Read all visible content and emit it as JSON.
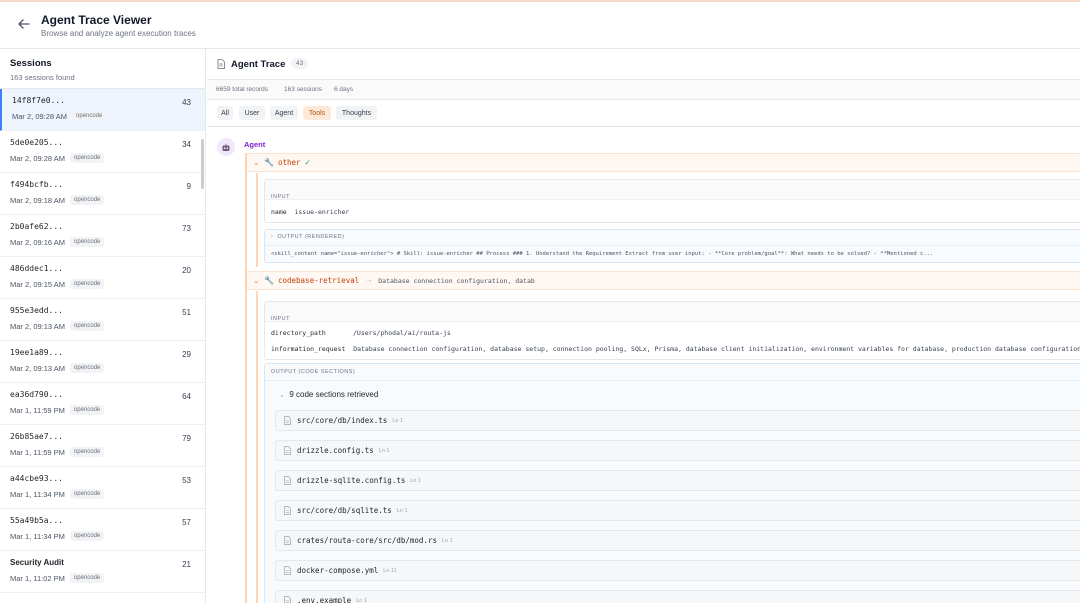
{
  "header": {
    "title": "Agent Trace Viewer",
    "subtitle": "Browse and analyze agent execution traces"
  },
  "sidebar": {
    "title": "Sessions",
    "count_text": "163 sessions found",
    "sessions": [
      {
        "name": "14f8f7e0...",
        "count": "43",
        "date": "Mar 2, 09:28 AM",
        "tag": "opencode"
      },
      {
        "name": "5de0e205...",
        "count": "34",
        "date": "Mar 2, 09:28 AM",
        "tag": "opencode"
      },
      {
        "name": "f494bcfb...",
        "count": "9",
        "date": "Mar 2, 09:18 AM",
        "tag": "opencode"
      },
      {
        "name": "2b0afe62...",
        "count": "73",
        "date": "Mar 2, 09:16 AM",
        "tag": "opencode"
      },
      {
        "name": "486ddec1...",
        "count": "20",
        "date": "Mar 2, 09:15 AM",
        "tag": "opencode"
      },
      {
        "name": "955e3edd...",
        "count": "51",
        "date": "Mar 2, 09:13 AM",
        "tag": "opencode"
      },
      {
        "name": "19ee1a89...",
        "count": "29",
        "date": "Mar 2, 09:13 AM",
        "tag": "opencode"
      },
      {
        "name": "ea36d790...",
        "count": "64",
        "date": "Mar 1, 11:59 PM",
        "tag": "opencode"
      },
      {
        "name": "26b85ae7...",
        "count": "79",
        "date": "Mar 1, 11:59 PM",
        "tag": "opencode"
      },
      {
        "name": "a44cbe93...",
        "count": "53",
        "date": "Mar 1, 11:34 PM",
        "tag": "opencode"
      },
      {
        "name": "55a49b5a...",
        "count": "57",
        "date": "Mar 1, 11:34 PM",
        "tag": "opencode"
      },
      {
        "name": "Security Audit",
        "count": "21",
        "date": "Mar 1, 11:02 PM",
        "tag": "opencode"
      }
    ]
  },
  "main": {
    "title": "Agent Trace",
    "badge": "43",
    "stats": {
      "records": "6659 total records",
      "sessions": "163 sessions",
      "days": "6 days"
    },
    "filters": [
      "All",
      "User",
      "Agent",
      "Tools",
      "Thoughts"
    ],
    "active_filter": "Tools",
    "agent_label": "Agent",
    "tool1": {
      "name": "other",
      "check": "✓",
      "input_label": "INPUT",
      "input_key": "name",
      "input_value": "issue-enricher",
      "output_label": "OUTPUT (RENDERED)",
      "output_text": "<skill_content name=\"issue-enricher\"> # Skill: issue-enricher ## Process ### 1. Understand the Requirement Extract from user input: - **Core problem/goal**: What needs to be solved? - **Mentioned c..."
    },
    "tool2": {
      "name": "codebase-retrieval",
      "arrow": "→",
      "desc": "Database connection configuration, datab",
      "input_label": "INPUT",
      "dir_key": "directory_path",
      "dir_value": "/Users/phodal/ai/routa-js",
      "req_key": "information_request",
      "req_value": "Database connection configuration, database setup, connection pooling, SQLx, Prisma, database client initialization, environment variables for database, production database configuration",
      "output_label": "OUTPUT (CODE SECTIONS)",
      "sections_summary": "9 code sections retrieved",
      "files": [
        {
          "path": "src/core/db/index.ts",
          "ln": "Ln 1"
        },
        {
          "path": "drizzle.config.ts",
          "ln": "Ln 1"
        },
        {
          "path": "drizzle-sqlite.config.ts",
          "ln": "Ln 1"
        },
        {
          "path": "src/core/db/sqlite.ts",
          "ln": "Ln 1"
        },
        {
          "path": "crates/routa-core/src/db/mod.rs",
          "ln": "Ln 1"
        },
        {
          "path": "docker-compose.yml",
          "ln": "Ln 11"
        },
        {
          "path": ".env.example",
          "ln": "Ln 1"
        }
      ]
    }
  },
  "colors": {
    "accent": "#3b82f6",
    "tool": "#c2410c",
    "agent": "#7e22ce"
  },
  "icons": [
    "back-arrow-icon",
    "document-icon",
    "agent-bot-icon",
    "wrench-icon",
    "chevron-down-icon",
    "chevron-right-icon",
    "file-icon"
  ]
}
